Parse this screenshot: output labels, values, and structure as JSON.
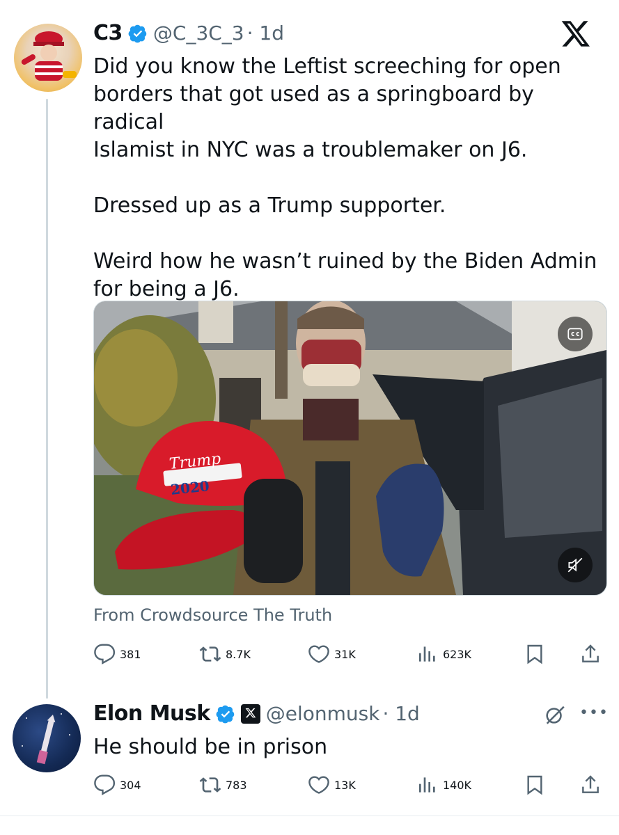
{
  "app_logo": "x-logo-icon",
  "tweet1": {
    "name": "C3",
    "handle": "@C_3C_3",
    "time": "· 1d",
    "text": "Did you know the Leftist screeching for open\nborders that got used as a springboard by radical\nIslamist in NYC was a troublemaker on J6.\n\nDressed up as a Trump supporter.\n\nWeird how he wasn’t ruined by the Biden Admin\nfor being a J6.",
    "media_source": "From Crowdsource The Truth",
    "hat_text": "Trump",
    "hat_year": "2020",
    "replies": "381",
    "reposts": "8.7K",
    "likes": "31K",
    "views": "623K"
  },
  "tweet2": {
    "name": "Elon Musk",
    "handle": "@elonmusk",
    "time": "· 1d",
    "text": "He should be in prison",
    "replies": "304",
    "reposts": "783",
    "likes": "13K",
    "views": "140K"
  },
  "colors": {
    "verified": "#1d9bf0",
    "secondary_text": "#536471",
    "hat_red": "#d81b2a"
  }
}
